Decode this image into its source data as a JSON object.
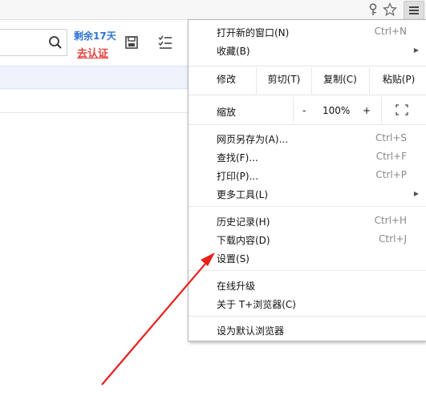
{
  "toolbar": {
    "icons": [
      "key-icon",
      "star-icon",
      "menu-icon"
    ]
  },
  "page": {
    "days_left": "剩余17天",
    "verify_link": "去认证",
    "icons": [
      "search-icon",
      "save-icon",
      "list-check-icon"
    ]
  },
  "menu": {
    "new_window": {
      "label": "打开新的窗口(N)",
      "shortcut": "Ctrl+N"
    },
    "bookmarks": {
      "label": "收藏(B)"
    },
    "edit": {
      "label": "修改",
      "cut": "剪切(T)",
      "copy": "复制(C)",
      "paste": "粘贴(P)"
    },
    "zoom": {
      "label": "缩放",
      "minus": "-",
      "level": "100%",
      "plus": "+"
    },
    "save_as": {
      "label": "网页另存为(A)...",
      "shortcut": "Ctrl+S"
    },
    "find": {
      "label": "查找(F)...",
      "shortcut": "Ctrl+F"
    },
    "print": {
      "label": "打印(P)...",
      "shortcut": "Ctrl+P"
    },
    "more_tools": {
      "label": "更多工具(L)"
    },
    "history": {
      "label": "历史记录(H)",
      "shortcut": "Ctrl+H"
    },
    "downloads": {
      "label": "下载内容(D)",
      "shortcut": "Ctrl+J"
    },
    "settings": {
      "label": "设置(S)"
    },
    "online_upgrade": {
      "label": "在线升级"
    },
    "about": {
      "label": "关于 T+浏览器(C)"
    },
    "set_default": {
      "label": "设为默认浏览器"
    }
  },
  "annotation": {
    "arrow_color": "#e8201c"
  },
  "colors": {
    "accent_blue": "#2f76d6",
    "link_red": "#e8413c"
  }
}
